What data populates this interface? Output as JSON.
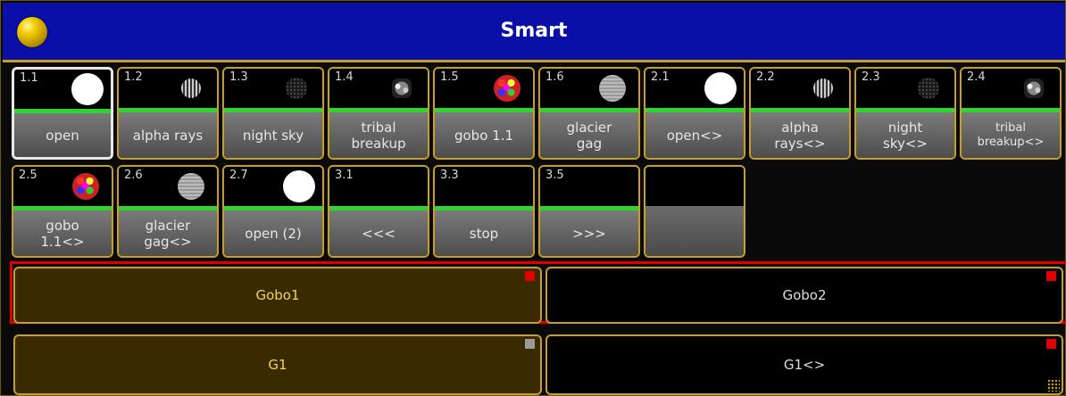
{
  "window": {
    "title": "Smart"
  },
  "pool": {
    "row1": [
      {
        "num": "1.1",
        "label": "open",
        "gobo": "open-gobo-icon",
        "selected": true
      },
      {
        "num": "1.2",
        "label": "alpha rays",
        "gobo": "alpha-rays-gobo-icon"
      },
      {
        "num": "1.3",
        "label": "night sky",
        "gobo": "night-sky-gobo-icon"
      },
      {
        "num": "1.4",
        "label": "tribal\nbreakup",
        "gobo": "tribal-gobo-icon"
      },
      {
        "num": "1.5",
        "label": "gobo 1.1",
        "gobo": "color-gobo-icon"
      },
      {
        "num": "1.6",
        "label": "glacier\ngag",
        "gobo": "glacier-gobo-icon"
      },
      {
        "num": "2.1",
        "label": "open<>",
        "gobo": "open-gobo-icon"
      },
      {
        "num": "2.2",
        "label": "alpha\nrays<>",
        "gobo": "alpha-rays-gobo-icon"
      },
      {
        "num": "2.3",
        "label": "night\nsky<>",
        "gobo": "night-sky-gobo-icon"
      },
      {
        "num": "2.4",
        "label": "tribal\nbreakup<>",
        "gobo": "tribal-gobo-icon"
      }
    ],
    "row2": [
      {
        "num": "2.5",
        "label": "gobo\n1.1<>",
        "gobo": "color-gobo-icon"
      },
      {
        "num": "2.6",
        "label": "glacier\ngag<>",
        "gobo": "glacier-gobo-icon"
      },
      {
        "num": "2.7",
        "label": "open (2)",
        "gobo": "open-gobo-icon"
      },
      {
        "num": "3.1",
        "label": "<<<",
        "gobo": ""
      },
      {
        "num": "3.3",
        "label": "stop",
        "gobo": ""
      },
      {
        "num": "3.5",
        "label": ">>>",
        "gobo": ""
      },
      {
        "num": "",
        "label": "",
        "gobo": ""
      }
    ]
  },
  "presets": {
    "gobo1": "Gobo1",
    "gobo2": "Gobo2",
    "g1": "G1",
    "g1_alt": "G1<>"
  },
  "colors": {
    "title_bar": "#0a0fa8",
    "border": "#c8a020",
    "active_bar": "#2fd42f",
    "selection_red": "#e00000",
    "active_text": "#f0d25a"
  }
}
